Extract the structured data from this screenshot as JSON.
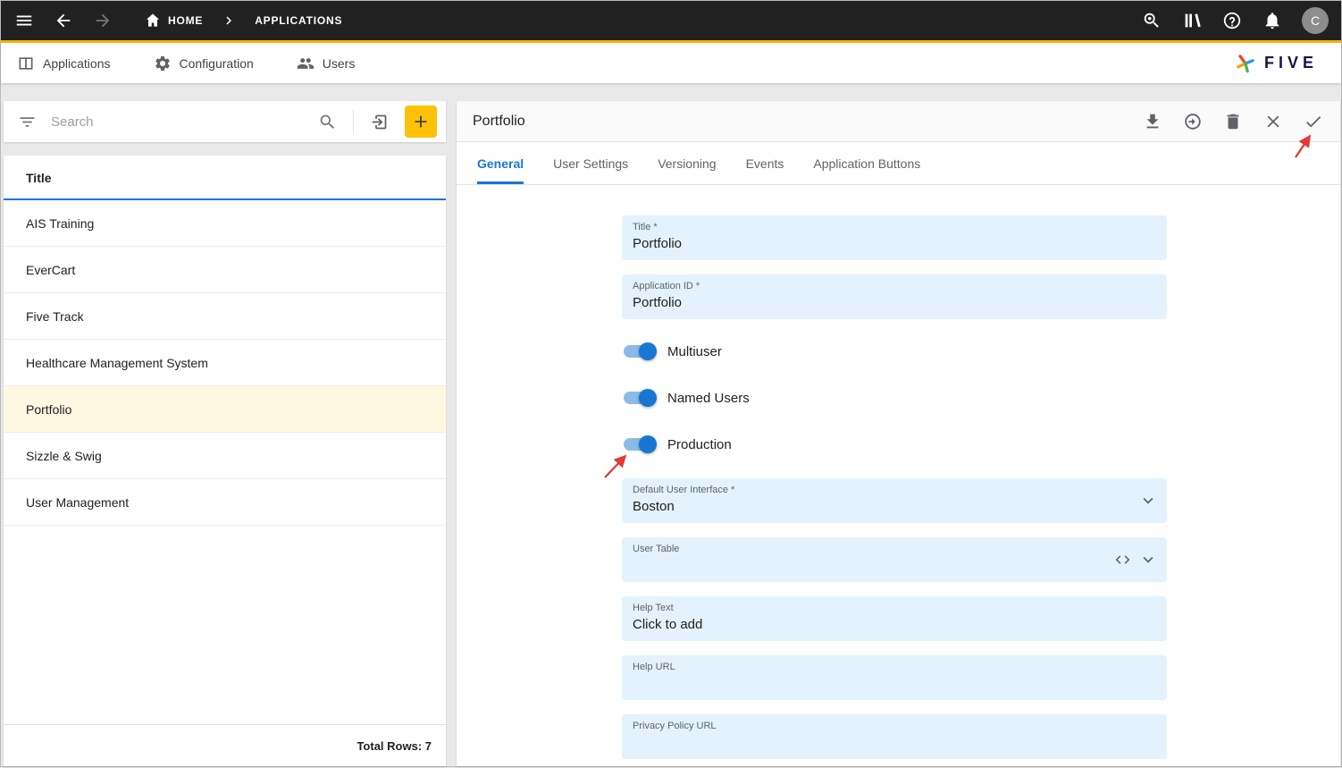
{
  "topbar": {
    "breadcrumb": {
      "home": "HOME",
      "current": "APPLICATIONS"
    },
    "icons": [
      "menu-icon",
      "back-icon",
      "forward-icon",
      "inspect-icon",
      "docs-icon",
      "help-icon",
      "notifications-icon"
    ],
    "avatar_initial": "C"
  },
  "menubar": {
    "items": [
      {
        "label": "Applications",
        "icon": "applications-icon"
      },
      {
        "label": "Configuration",
        "icon": "configuration-gear-icon"
      },
      {
        "label": "Users",
        "icon": "users-icon"
      }
    ],
    "brand": "FIVE"
  },
  "list_panel": {
    "search": {
      "placeholder": "Search",
      "value": ""
    },
    "toolbar_icons": [
      "filter-icon",
      "search-icon",
      "import-icon",
      "add-icon"
    ],
    "header": "Title",
    "rows": [
      "AIS Training",
      "EverCart",
      "Five Track",
      "Healthcare Management System",
      "Portfolio",
      "Sizzle & Swig",
      "User Management"
    ],
    "selected_row": "Portfolio",
    "footer_label": "Total Rows: 7"
  },
  "detail_panel": {
    "title": "Portfolio",
    "header_icons": [
      "download-icon",
      "open-icon",
      "delete-icon",
      "close-icon",
      "save-check-icon"
    ],
    "tabs": [
      "General",
      "User Settings",
      "Versioning",
      "Events",
      "Application Buttons"
    ],
    "active_tab": "General",
    "form": {
      "title": {
        "label": "Title *",
        "value": "Portfolio"
      },
      "application_id": {
        "label": "Application ID *",
        "value": "Portfolio"
      },
      "toggles": [
        {
          "label": "Multiuser",
          "state": "on"
        },
        {
          "label": "Named Users",
          "state": "on"
        },
        {
          "label": "Production",
          "state": "on"
        }
      ],
      "default_user_interface": {
        "label": "Default User Interface *",
        "value": "Boston"
      },
      "user_table": {
        "label": "User Table",
        "value": ""
      },
      "help_text": {
        "label": "Help Text",
        "value": "Click to add"
      },
      "help_url": {
        "label": "Help URL",
        "value": ""
      },
      "privacy_policy_url": {
        "label": "Privacy Policy URL",
        "value": ""
      }
    }
  },
  "colors": {
    "topbar_bg": "#212121",
    "accent_yellow": "#FFC107",
    "primary_blue": "#1976D2",
    "field_bg": "#E3F2FD",
    "selected_row_bg": "#FFF8E1",
    "annotation_red": "#E53935"
  }
}
